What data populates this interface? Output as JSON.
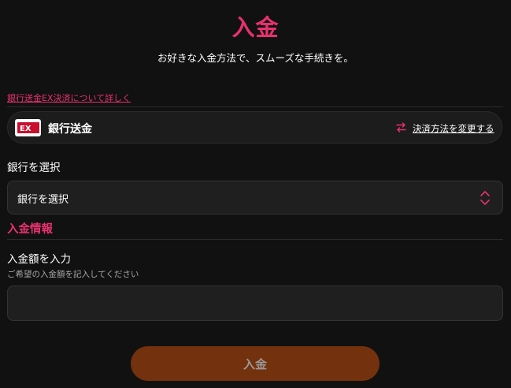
{
  "header": {
    "title": "入金",
    "subtitle": "お好きな入金方法で、スムーズな手続きを。"
  },
  "method": {
    "details_link": "銀行送金EX決済について詳しく",
    "name": "銀行送金",
    "logo_text": "EX",
    "change_label": "決済方法を変更する",
    "change_icon": "swap-arrows-icon",
    "logo_icon": "ex-logo-icon"
  },
  "bank": {
    "label": "銀行を選択",
    "selected": "銀行を選択",
    "select_icon": "chevron-up-down-icon"
  },
  "deposit_info": {
    "heading": "入金情報",
    "amount_label": "入金額を入力",
    "amount_hint": "ご希望の入金額を記入してください",
    "amount_value": ""
  },
  "submit": {
    "label": "入金"
  },
  "colors": {
    "accent": "#e8316f",
    "background": "#111111",
    "button": "#74310d"
  }
}
